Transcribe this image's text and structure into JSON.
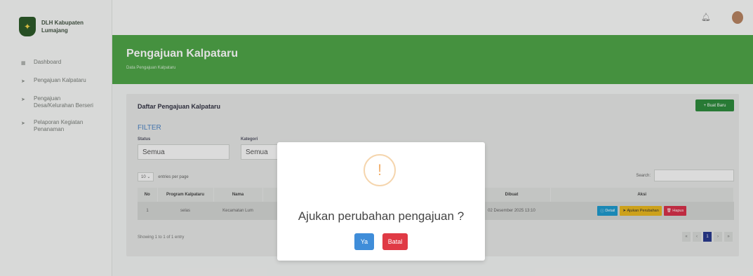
{
  "brand": {
    "name": "DLH Kabupaten Lumajang"
  },
  "sidebar": {
    "items": [
      {
        "label": "Dashboard",
        "icon": "dashboard-icon"
      },
      {
        "label": "Pengajuan Kalpataru",
        "icon": "send-icon"
      },
      {
        "label": "Pengajuan Desa/Kelurahan Berseri",
        "icon": "send-icon"
      },
      {
        "label": "Pelaporan Kegiatan Penanaman",
        "icon": "send-icon"
      }
    ]
  },
  "header": {
    "title": "Pengajuan Kalpataru",
    "subtitle": "Data Pengajuan Kalpataru"
  },
  "card": {
    "title": "Daftar Pengajuan Kalpataru",
    "new_button": "+ Buat Baru",
    "filter_label": "FILTER",
    "status_label": "Status",
    "status_value": "Semua",
    "kategori_label": "Kategori",
    "kategori_value": "Semua",
    "entries_value": "10",
    "entries_suffix": "entries per page",
    "search_label": "Search:"
  },
  "table": {
    "headers": [
      "No",
      "Program Kalpataru",
      "Nama",
      "",
      "",
      "",
      "Dibuat",
      "Aksi"
    ],
    "row": {
      "no": "1",
      "program": "selas",
      "nama": "Kecamatan Lum",
      "dibuat": "02 Desember 2025 13:10",
      "btn_detail": "Detail",
      "btn_ajukan": "Ajukan Perubahan",
      "btn_hapus": "Hapus"
    }
  },
  "footer": {
    "showing": "Showing 1 to 1 of 1 entry",
    "pages": [
      "«",
      "‹",
      "1",
      "›",
      "»"
    ]
  },
  "modal": {
    "message": "Ajukan perubahan pengajuan ?",
    "yes": "Ya",
    "cancel": "Batal"
  },
  "colors": {
    "accent_green": "#4fa648",
    "warn": "#f1b170",
    "ya": "#3f8dd9",
    "batal": "#e03a45"
  }
}
